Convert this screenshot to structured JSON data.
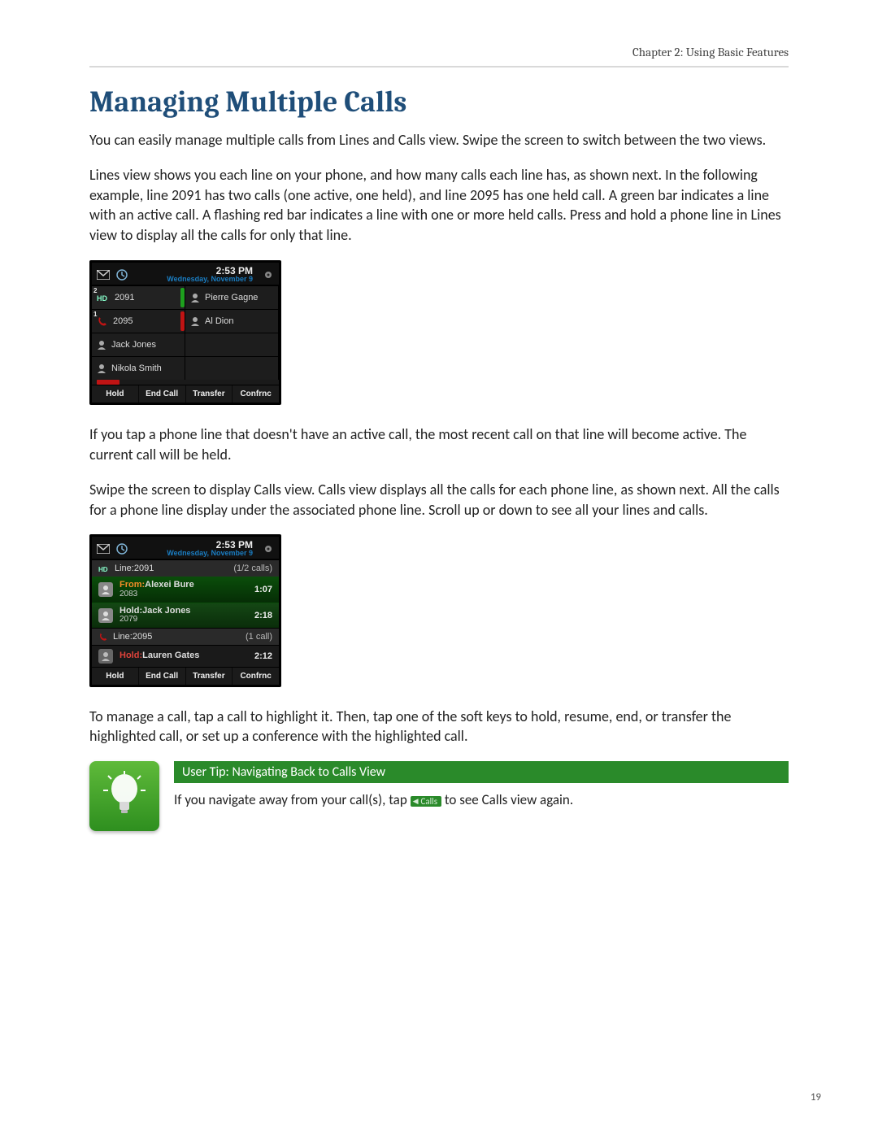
{
  "chapter_header": "Chapter 2: Using Basic Features",
  "title": "Managing Multiple Calls",
  "para1": "You can easily manage multiple calls from Lines and Calls view. Swipe the screen to switch between the two views.",
  "para2": "Lines view shows you each line on your phone, and how many calls each line has, as shown next. In the following example, line 2091 has two calls (one active, one held), and line 2095 has one held call. A green bar indicates a line with an active call. A flashing red bar indicates a line with one or more held calls. Press and hold a phone line in Lines view to display all the calls for only that line.",
  "para3": "If you tap a phone line that doesn't have an active call, the most recent call on that line will become active. The current call will be held.",
  "para4": "Swipe the screen to display Calls view. Calls view displays all the calls for each phone line, as shown next. All the calls for a phone line display under the associated phone line. Scroll up or down to see all your lines and calls.",
  "para5": "To manage a call, tap a call to highlight it. Then, tap one of the soft keys to hold, resume, end, or transfer the highlighted call, or set up a conference with the highlighted call.",
  "page_number": "19",
  "status": {
    "time": "2:53 PM",
    "date": "Wednesday, November 9"
  },
  "lines_view": {
    "cells": [
      {
        "ext": "2091",
        "badge": "2",
        "bar": "green"
      },
      {
        "name": "Pierre Gagne"
      },
      {
        "ext": "2095",
        "badge": "1",
        "bar": "red"
      },
      {
        "name": "Al Dion"
      },
      {
        "name": "Jack Jones"
      },
      {},
      {
        "name": "Nikola Smith"
      },
      {}
    ]
  },
  "calls_view": {
    "line1": {
      "label": "Line:2091",
      "count": "(1/2 calls)"
    },
    "call_a": {
      "status": "From:",
      "name": "Alexei Bure",
      "ext": "2083",
      "timer": "1:07"
    },
    "call_b": {
      "status": "Hold:",
      "name": "Jack Jones",
      "ext": "2079",
      "timer": "2:18"
    },
    "line2": {
      "label": "Line:2095",
      "count": "(1 call)"
    },
    "call_c": {
      "status": "Hold:",
      "name": "Lauren Gates",
      "timer": "2:12"
    }
  },
  "softkeys": [
    "Hold",
    "End Call",
    "Transfer",
    "Confrnc"
  ],
  "tip": {
    "header": "User Tip: Navigating Back to Calls View",
    "pre": "If you navigate away from your call(s), tap ",
    "chip": "Calls",
    "post": " to see Calls view again."
  }
}
